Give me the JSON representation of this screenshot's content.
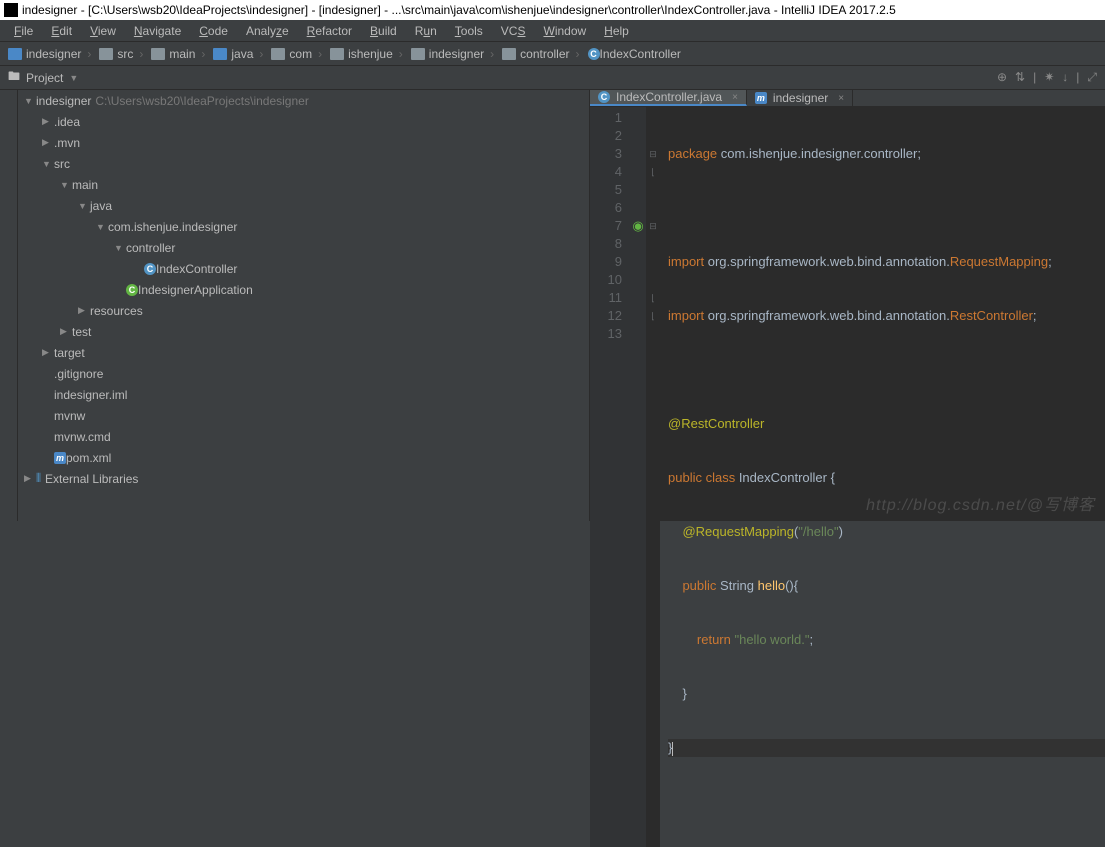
{
  "title": "indesigner - [C:\\Users\\wsb20\\IdeaProjects\\indesigner] - [indesigner] - ...\\src\\main\\java\\com\\ishenjue\\indesigner\\controller\\IndexController.java - IntelliJ IDEA 2017.2.5",
  "menu": [
    "File",
    "Edit",
    "View",
    "Navigate",
    "Code",
    "Analyze",
    "Refactor",
    "Build",
    "Run",
    "Tools",
    "VCS",
    "Window",
    "Help"
  ],
  "breadcrumb": [
    {
      "icon": "folder-blue",
      "label": "indesigner"
    },
    {
      "icon": "folder",
      "label": "src"
    },
    {
      "icon": "folder",
      "label": "main"
    },
    {
      "icon": "folder-blue",
      "label": "java"
    },
    {
      "icon": "folder",
      "label": "com"
    },
    {
      "icon": "folder",
      "label": "ishenjue"
    },
    {
      "icon": "folder",
      "label": "indesigner"
    },
    {
      "icon": "folder",
      "label": "controller"
    },
    {
      "icon": "class",
      "label": "IndexController"
    }
  ],
  "project_label": "Project",
  "tb_icons": [
    "⊕",
    "⇅",
    "|",
    "✷",
    "↓",
    "|",
    "⤢"
  ],
  "tree": [
    {
      "d": 0,
      "arrow": "▼",
      "icon": "folder-blue",
      "label": "indesigner",
      "path": "C:\\Users\\wsb20\\IdeaProjects\\indesigner"
    },
    {
      "d": 1,
      "arrow": "▶",
      "icon": "folder",
      "label": ".idea"
    },
    {
      "d": 1,
      "arrow": "▶",
      "icon": "folder",
      "label": ".mvn"
    },
    {
      "d": 1,
      "arrow": "▼",
      "icon": "folder",
      "label": "src"
    },
    {
      "d": 2,
      "arrow": "▼",
      "icon": "folder",
      "label": "main"
    },
    {
      "d": 3,
      "arrow": "▼",
      "icon": "folder-blue",
      "label": "java"
    },
    {
      "d": 4,
      "arrow": "▼",
      "icon": "folder",
      "label": "com.ishenjue.indesigner"
    },
    {
      "d": 5,
      "arrow": "▼",
      "icon": "folder",
      "label": "controller"
    },
    {
      "d": 6,
      "arrow": "",
      "icon": "class",
      "label": "IndexController"
    },
    {
      "d": 5,
      "arrow": "",
      "icon": "class-g",
      "label": "IndesignerApplication"
    },
    {
      "d": 3,
      "arrow": "▶",
      "icon": "folder",
      "label": "resources"
    },
    {
      "d": 2,
      "arrow": "▶",
      "icon": "folder",
      "label": "test"
    },
    {
      "d": 1,
      "arrow": "▶",
      "icon": "target",
      "label": "target"
    },
    {
      "d": 1,
      "arrow": "",
      "icon": "file",
      "label": ".gitignore"
    },
    {
      "d": 1,
      "arrow": "",
      "icon": "file",
      "label": "indesigner.iml"
    },
    {
      "d": 1,
      "arrow": "",
      "icon": "file",
      "label": "mvnw"
    },
    {
      "d": 1,
      "arrow": "",
      "icon": "file",
      "label": "mvnw.cmd"
    },
    {
      "d": 1,
      "arrow": "",
      "icon": "m",
      "label": "pom.xml"
    },
    {
      "d": 0,
      "arrow": "▶",
      "icon": "lib",
      "label": "External Libraries"
    }
  ],
  "tabs": [
    {
      "icon": "class",
      "label": "IndexController.java",
      "active": true
    },
    {
      "icon": "m",
      "label": "indesigner",
      "active": false
    }
  ],
  "code": {
    "lines": [
      "1",
      "2",
      "3",
      "4",
      "5",
      "6",
      "7",
      "8",
      "9",
      "10",
      "11",
      "12",
      "13"
    ],
    "l1_kw": "package",
    "l1_rest": " com.ishenjue.indesigner.controller;",
    "l3_kw": "import",
    "l3_rest": " org.springframework.web.bind.annotation.",
    "l3_cls": "RequestMapping",
    "l3_sc": ";",
    "l4_kw": "import",
    "l4_rest": " org.springframework.web.bind.annotation.",
    "l4_cls": "RestController",
    "l4_sc": ";",
    "l6": "@RestController",
    "l7_kw1": "public class ",
    "l7_cls": "IndexController",
    "l7_b": " {",
    "l8_ann": "@RequestMapping",
    "l8_p": "(",
    "l8_str": "\"/hello\"",
    "l8_cp": ")",
    "l9_kw": "public ",
    "l9_t": "String ",
    "l9_m": "hello",
    "l9_p": "(){",
    "l10_kw": "return ",
    "l10_str": "\"hello world.\"",
    "l10_sc": ";",
    "l11": "    }",
    "l12": "}"
  },
  "watermark": "http://blog.csdn.net/@写博客"
}
